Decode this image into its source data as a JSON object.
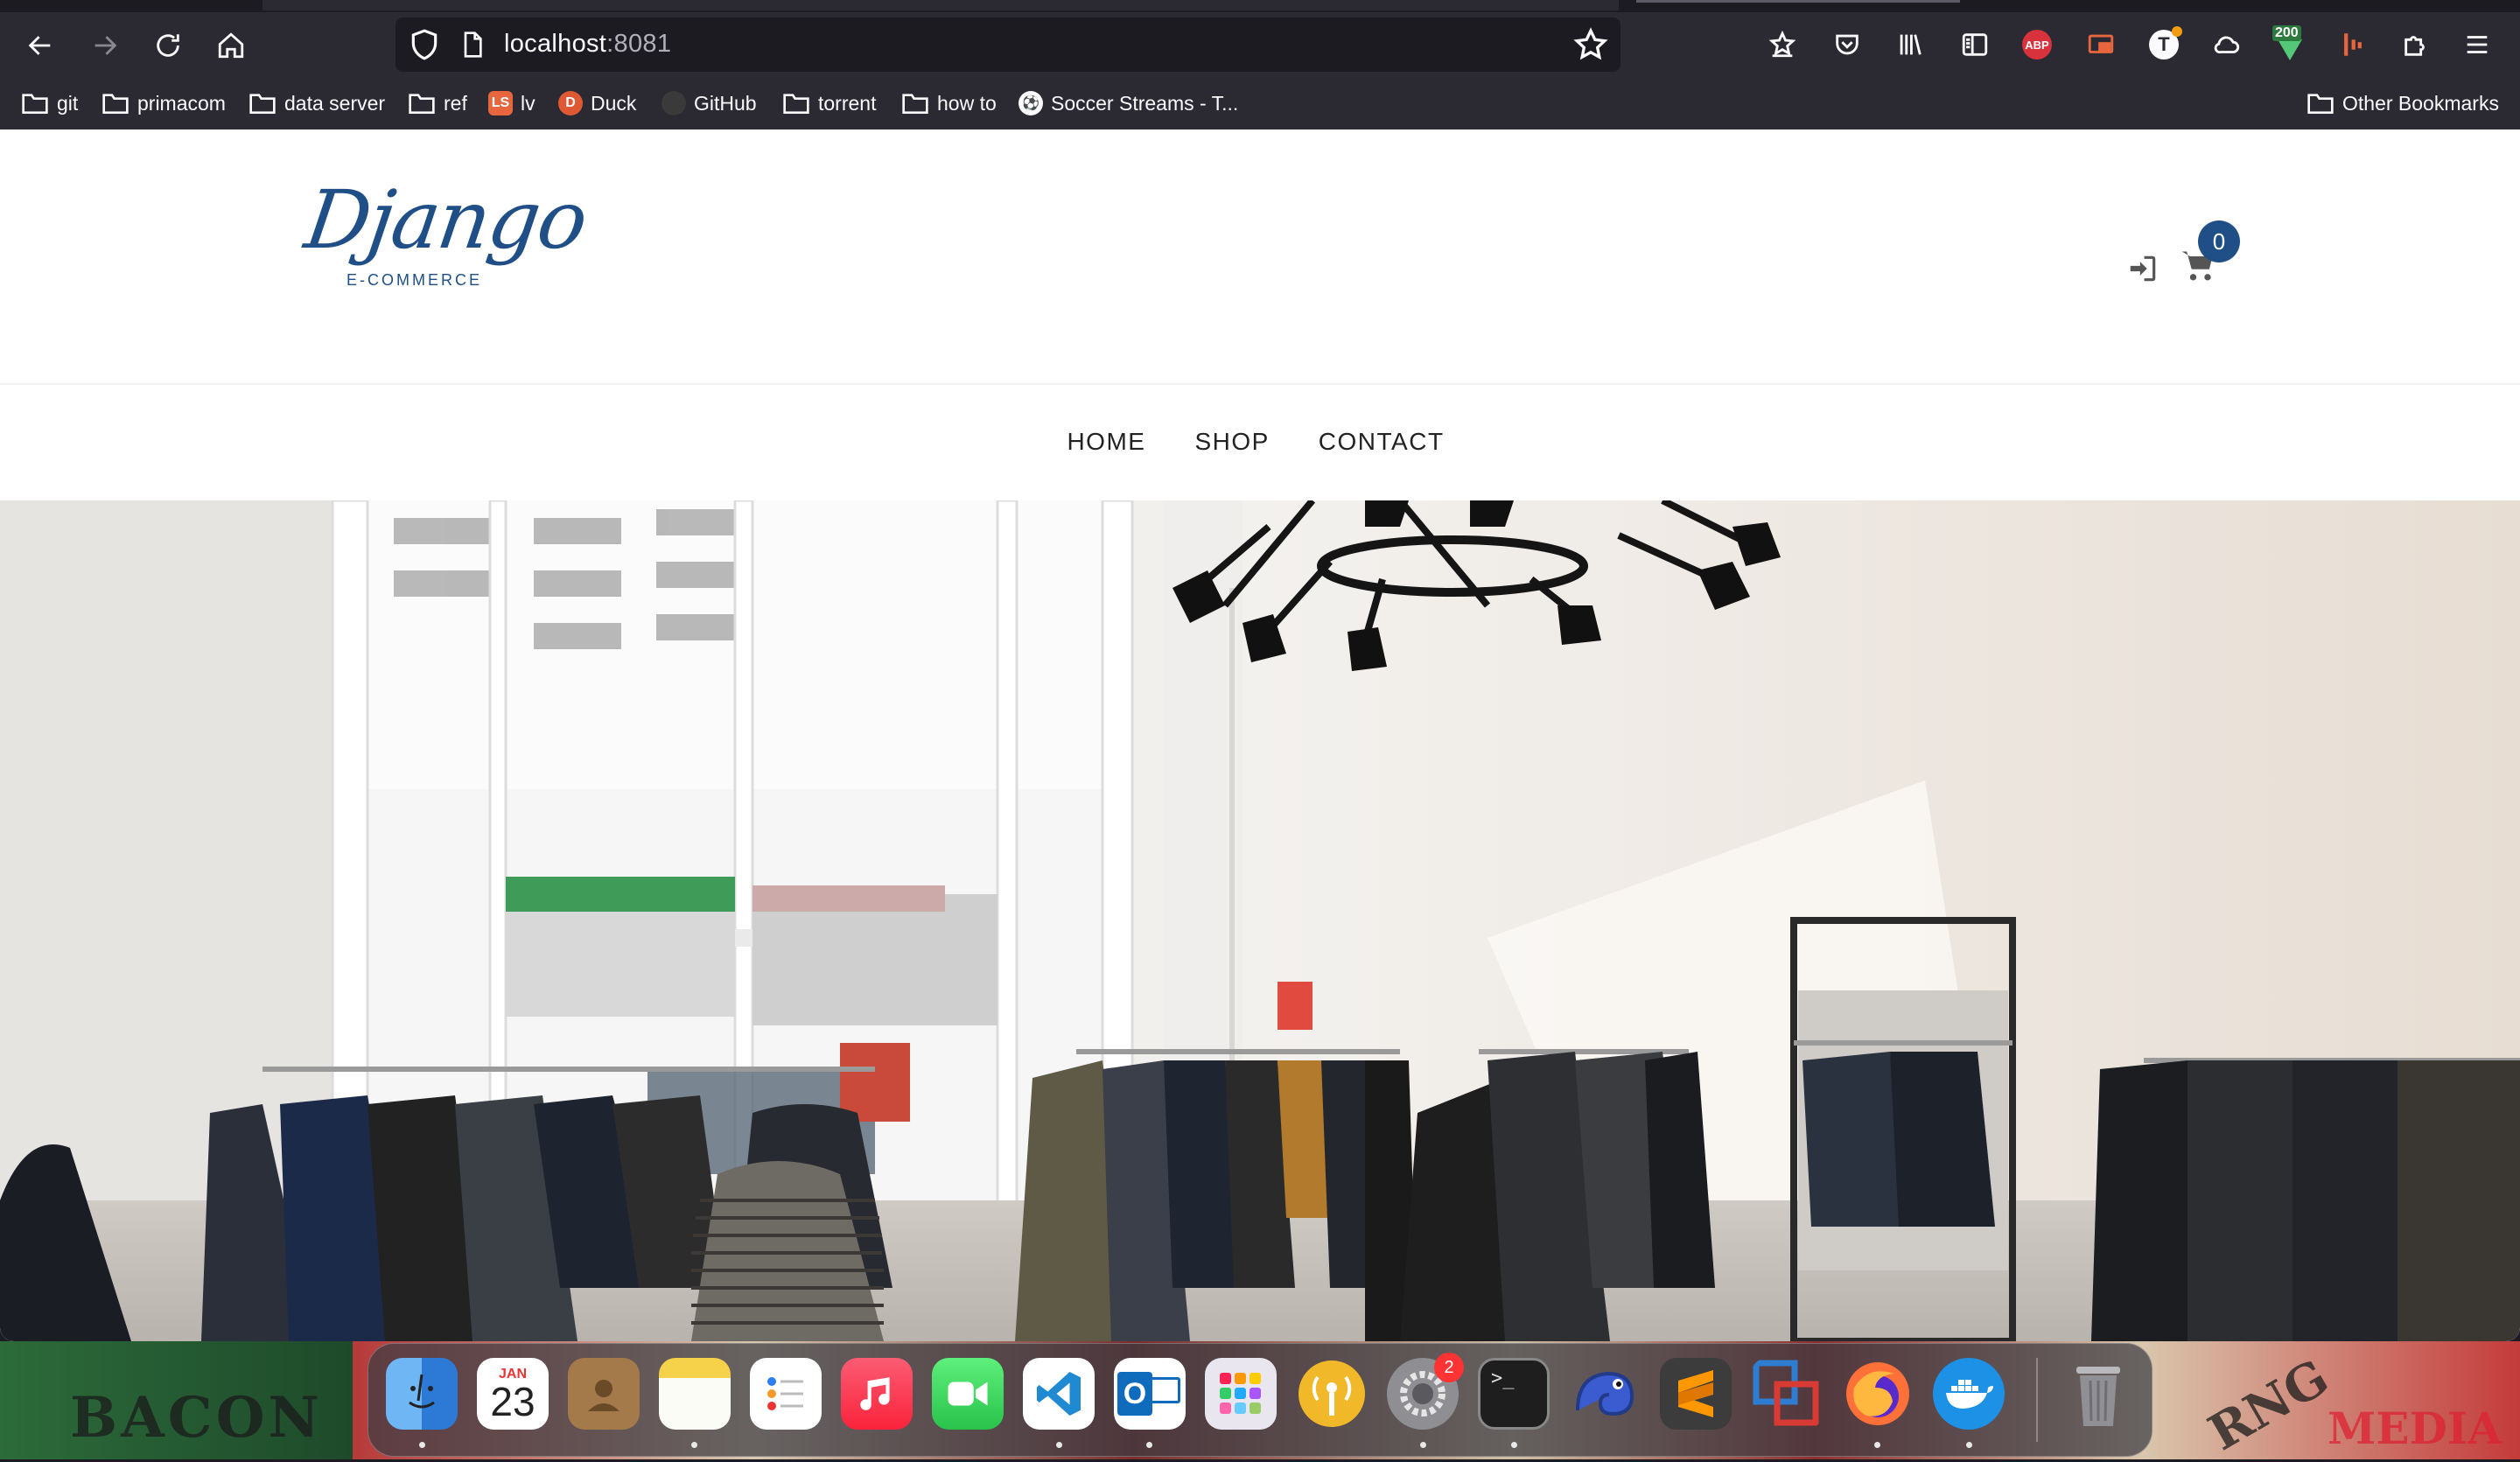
{
  "browser": {
    "url_host": "localhost",
    "url_port": ":8081",
    "bookmarks": [
      {
        "label": "git",
        "type": "folder"
      },
      {
        "label": "primacom",
        "type": "folder"
      },
      {
        "label": "data server",
        "type": "folder"
      },
      {
        "label": "ref",
        "type": "folder"
      },
      {
        "label": "lv",
        "type": "site"
      },
      {
        "label": "Duck",
        "type": "site"
      },
      {
        "label": "GitHub",
        "type": "site"
      },
      {
        "label": "torrent",
        "type": "folder"
      },
      {
        "label": "how to",
        "type": "folder"
      },
      {
        "label": "Soccer Streams - T...",
        "type": "site"
      }
    ],
    "other_bookmarks": "Other Bookmarks",
    "extensions": {
      "abp": "ABP",
      "t": "T",
      "badge_200": "200"
    },
    "icons": [
      "back-arrow-icon",
      "forward-arrow-icon",
      "reload-icon",
      "home-icon",
      "shield-icon",
      "page-icon",
      "bookmark-star-icon",
      "save-to-pocket-icon",
      "pocket-icon",
      "library-icon",
      "sidebar-icon",
      "menu-icon"
    ]
  },
  "site": {
    "logo_text": "Django",
    "logo_subtext": "E-COMMERCE",
    "cart_count": "0",
    "nav": [
      "HOME",
      "SHOP",
      "CONTACT"
    ],
    "accent_color": "#1f4f86"
  },
  "desktop": {
    "wallpaper_words": [
      "BACON",
      "RNG",
      "MEDIA"
    ],
    "calendar_month": "JAN",
    "calendar_day": "23",
    "settings_badge": "2",
    "outlook_letter": "O",
    "dock_apps": [
      "Finder",
      "Calendar",
      "Contacts",
      "Notes",
      "Reminders",
      "Music",
      "FaceTime",
      "Visual Studio Code",
      "Outlook",
      "Launchpad",
      "Podcast Capture",
      "System Preferences",
      "Terminal",
      "Chameleon",
      "Sublime Text",
      "Parallels",
      "Firefox",
      "Docker",
      "Trash"
    ]
  }
}
